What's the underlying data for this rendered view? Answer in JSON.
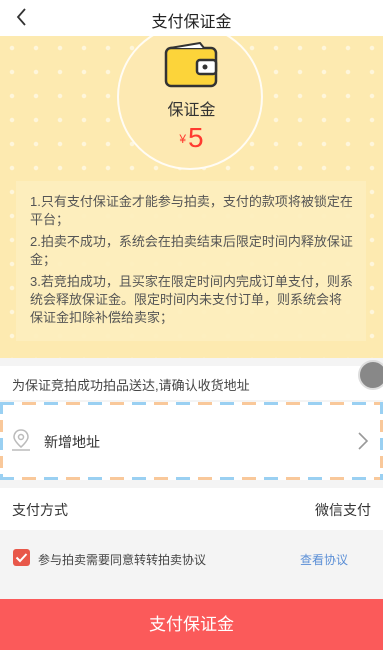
{
  "header": {
    "title": "支付保证金"
  },
  "hero": {
    "label": "保证金",
    "currency": "¥",
    "amount": "5",
    "rules": [
      "1.只有支付保证金才能参与拍卖，支付的款项将被锁定在平台；",
      "2.拍卖不成功，系统会在拍卖结束后限定时间内释放保证金；",
      "3.若竞拍成功，且买家在限定时间内完成订单支付，则系统会释放保证金。限定时间内未支付订单，则系统会将保证金扣除补偿给卖家；"
    ]
  },
  "address": {
    "notice": "为保证竞拍成功拍品送达,请确认收货地址",
    "add_label": "新增地址"
  },
  "payment": {
    "label": "支付方式",
    "value": "微信支付"
  },
  "agreement": {
    "text": "参与拍卖需要同意转转拍卖协议",
    "link": "查看协议",
    "checked": true
  },
  "submit": {
    "label": "支付保证金"
  },
  "colors": {
    "primary": "#fb5a5a",
    "hero_bg": "#fdeab0",
    "link": "#5b8fd6",
    "amount": "#ff3b30"
  },
  "icons": [
    "back-icon",
    "wallet-icon",
    "location-icon",
    "chevron-right-icon",
    "check-icon",
    "floating-ball-icon"
  ]
}
